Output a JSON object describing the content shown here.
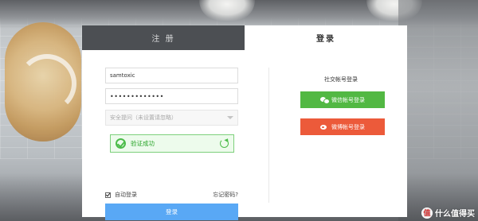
{
  "tabs": {
    "register": "注 册",
    "login": "登录"
  },
  "form": {
    "username_value": "samtoxic",
    "password_value": "•••••••••••••",
    "security_question_placeholder": "安全提问（未设置请忽略）",
    "verify_status": "验证成功",
    "remember_label": "自动登录",
    "remember_checked": true,
    "forgot_link": "忘记密码?",
    "login_button": "登录"
  },
  "social": {
    "title": "社交帐号登录",
    "wechat_button": "微信帐号登录",
    "weibo_button": "微博帐号登录"
  },
  "watermark": {
    "badge": "值",
    "text": "什么值得买"
  },
  "colors": {
    "tab_inactive_bg": "#4c4f53",
    "login_button": "#59a8f5",
    "wechat": "#52b843",
    "weibo": "#ec5a3a",
    "verify_green": "#4cbc4a"
  }
}
